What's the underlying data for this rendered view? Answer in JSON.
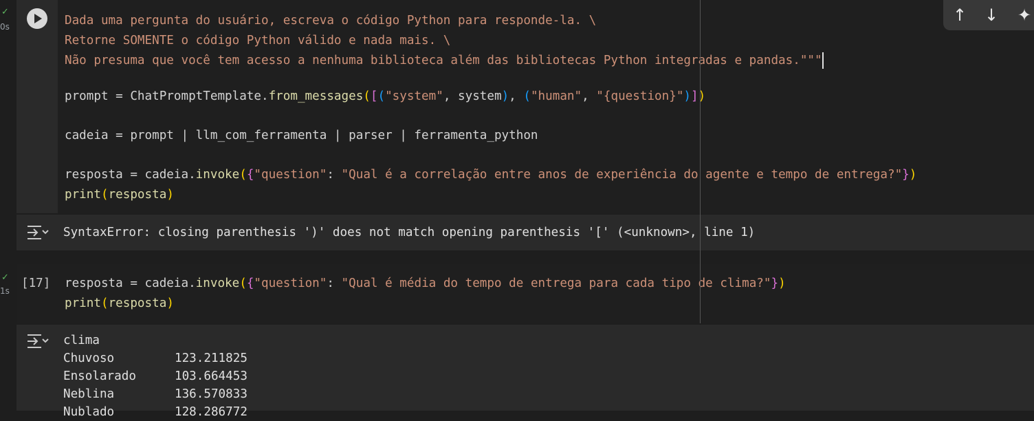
{
  "cell1": {
    "exec_time": "0s",
    "lines": [
      "Dada uma pergunta do usuário, escreva o código Python para responde-la. \\",
      "Retorne SOMENTE o código Python válido e nada mais. \\",
      "Não presuma que você tem acesso a nenhuma biblioteca além das bibliotecas Python integradas e pandas.\"\"\""
    ],
    "prompt_line": {
      "a": "prompt = ChatPromptTemplate.",
      "fn": "from_messages",
      "b": "(",
      "c": "[",
      "d": "(",
      "e": "\"system\"",
      "f": ", system",
      "g": ")",
      "h": ", ",
      "i": "(",
      "j": "\"human\"",
      "k": ", ",
      "l": "\"{question}\"",
      "m": ")",
      "n": "]",
      "o": ")"
    },
    "cadeia_line": "cadeia = prompt | llm_com_ferramenta | parser | ferramenta_python",
    "resposta_line": {
      "a": "resposta = cadeia.",
      "fn": "invoke",
      "b": "(",
      "c": "{",
      "d": "\"question\"",
      "e": ": ",
      "f": "\"Qual é a correlação entre anos de experiência do agente e tempo de entrega?\"",
      "g": "}",
      "h": ")"
    },
    "print_line": {
      "fn": "print",
      "a": "(",
      "b": "resposta",
      "c": ")"
    },
    "error": "SyntaxError: closing parenthesis ')' does not match opening parenthesis '[' (<unknown>, line 1)"
  },
  "cell2": {
    "exec_count": "[17]",
    "exec_time": "1s",
    "resposta_line": {
      "a": "resposta = cadeia.",
      "fn": "invoke",
      "b": "(",
      "c": "{",
      "d": "\"question\"",
      "e": ": ",
      "f": "\"Qual é média do tempo de entrega para cada tipo de clima?\"",
      "g": "}",
      "h": ")"
    },
    "print_line": {
      "fn": "print",
      "a": "(",
      "b": "resposta",
      "c": ")"
    },
    "output": {
      "header": "clima",
      "rows": [
        {
          "label": "Chuvoso",
          "value": "123.211825"
        },
        {
          "label": "Ensolarado",
          "value": "103.664453"
        },
        {
          "label": "Neblina",
          "value": "136.570833"
        },
        {
          "label": "Nublado",
          "value": "128.286772"
        }
      ]
    }
  },
  "toolbar": {
    "up_icon": "arrow-up-icon",
    "up": "↑",
    "down_icon": "arrow-down-icon",
    "down": "↓",
    "sparkle_icon": "sparkle-icon",
    "sparkle": "✦"
  }
}
